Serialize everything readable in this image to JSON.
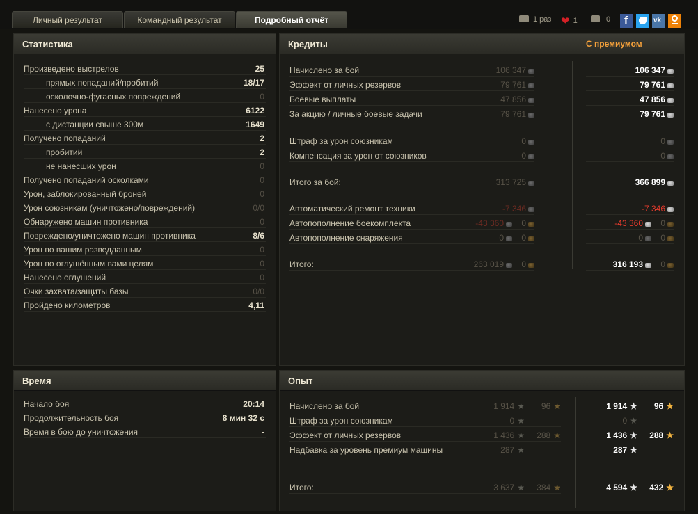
{
  "tabs": [
    {
      "label": "Личный результат"
    },
    {
      "label": "Командный результат"
    },
    {
      "label": "Подробный отчёт"
    }
  ],
  "header": {
    "views": "1 раз",
    "likes": "1",
    "comments": "0"
  },
  "stats": {
    "title": "Статистика",
    "rows": [
      {
        "label": "Произведено выстрелов",
        "value": "25",
        "sub": false,
        "dim": false
      },
      {
        "label": "прямых попаданий/пробитий",
        "value": "18/17",
        "sub": true,
        "dim": false
      },
      {
        "label": "осколочно-фугасных повреждений",
        "value": "0",
        "sub": true,
        "dim": true
      },
      {
        "label": "Нанесено урона",
        "value": "6122",
        "sub": false,
        "dim": false
      },
      {
        "label": "с дистанции свыше 300м",
        "value": "1649",
        "sub": true,
        "dim": false
      },
      {
        "label": "Получено попаданий",
        "value": "2",
        "sub": false,
        "dim": false
      },
      {
        "label": "пробитий",
        "value": "2",
        "sub": true,
        "dim": false
      },
      {
        "label": "не нанесших урон",
        "value": "0",
        "sub": true,
        "dim": true
      },
      {
        "label": "Получено попаданий осколками",
        "value": "0",
        "sub": false,
        "dim": true
      },
      {
        "label": "Урон, заблокированный броней",
        "value": "0",
        "sub": false,
        "dim": true
      },
      {
        "label": "Урон союзникам (уничтожено/повреждений)",
        "value": "0/0",
        "sub": false,
        "dim": true
      },
      {
        "label": "Обнаружено машин противника",
        "value": "0",
        "sub": false,
        "dim": true
      },
      {
        "label": "Повреждено/уничтожено машин противника",
        "value": "8/6",
        "sub": false,
        "dim": false
      },
      {
        "label": "Урон по вашим разведданным",
        "value": "0",
        "sub": false,
        "dim": true
      },
      {
        "label": "Урон по оглушённым вами целям",
        "value": "0",
        "sub": false,
        "dim": true
      },
      {
        "label": "Нанесено оглушений",
        "value": "0",
        "sub": false,
        "dim": true
      },
      {
        "label": "Очки захвата/защиты базы",
        "value": "0/0",
        "sub": false,
        "dim": true
      },
      {
        "label": "Пройдено километров",
        "value": "4,11",
        "sub": false,
        "dim": false
      }
    ]
  },
  "credits": {
    "title": "Кредиты",
    "premium_title": "С премиумом",
    "rows": [
      {
        "label": "Начислено за бой",
        "base": "106 347",
        "prem": "106 347"
      },
      {
        "label": "Эффект от личных резервов",
        "base": "79 761",
        "prem": "79 761"
      },
      {
        "label": "Боевые выплаты",
        "base": "47 856",
        "prem": "47 856"
      },
      {
        "label": "За акцию / личные боевые задачи",
        "base": "79 761",
        "prem": "79 761"
      },
      {
        "label": "Штраф за урон союзникам",
        "base": "0",
        "prem": "0"
      },
      {
        "label": "Компенсация за урон от союзников",
        "base": "0",
        "prem": "0"
      },
      {
        "label": "Итого за бой:",
        "base": "313 725",
        "prem": "366 899"
      },
      {
        "label": "Автоматический ремонт техники",
        "base": "-7 346",
        "prem": "-7 346"
      },
      {
        "label": "Автопополнение боекомплекта",
        "base": "-43 360",
        "base_gold": "0",
        "prem": "-43 360",
        "prem_gold": "0"
      },
      {
        "label": "Автопополнение снаряжения",
        "base": "0",
        "base_gold": "0",
        "prem": "0",
        "prem_gold": "0"
      },
      {
        "label": "Итого:",
        "base": "263 019",
        "base_gold": "0",
        "prem": "316 193",
        "prem_gold": "0"
      }
    ]
  },
  "time": {
    "title": "Время",
    "rows": [
      {
        "label": "Начало боя",
        "value": "20:14"
      },
      {
        "label": "Продолжительность боя",
        "value": "8 мин 32 с"
      },
      {
        "label": "Время в бою до уничтожения",
        "value": "-"
      }
    ]
  },
  "exp": {
    "title": "Опыт",
    "rows": [
      {
        "label": "Начислено за бой",
        "base": "1 914",
        "base_free": "96",
        "prem": "1 914",
        "prem_free": "96"
      },
      {
        "label": "Штраф за урон союзникам",
        "base": "0",
        "prem": "0"
      },
      {
        "label": "Эффект от личных резервов",
        "base": "1 436",
        "base_free": "288",
        "prem": "1 436",
        "prem_free": "288"
      },
      {
        "label": "Надбавка за уровень премиум машины",
        "base": "287",
        "prem": "287"
      },
      {
        "label": "Итого:",
        "base": "3 637",
        "base_free": "384",
        "prem": "4 594",
        "prem_free": "432"
      }
    ]
  }
}
